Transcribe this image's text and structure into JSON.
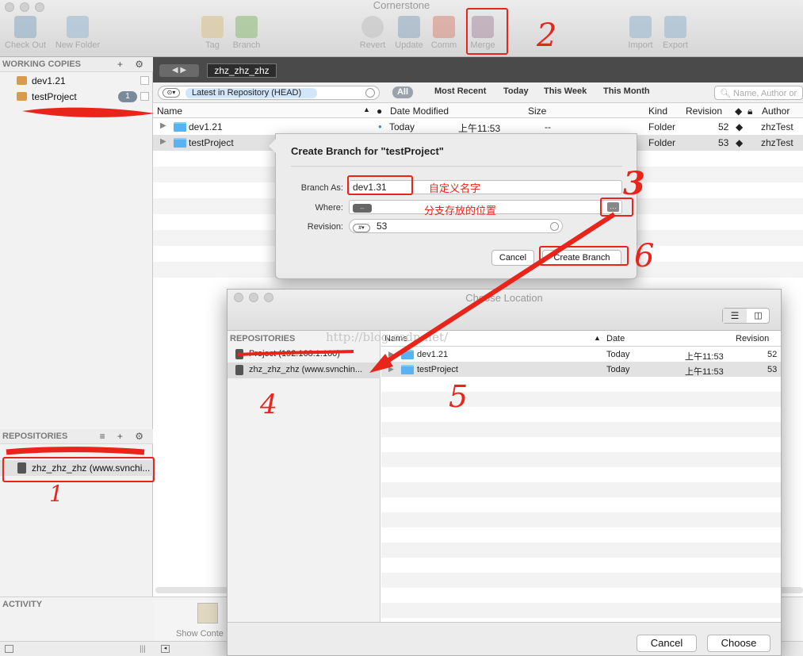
{
  "window": {
    "title": "Cornerstone"
  },
  "toolbar": [
    {
      "label": "Check Out"
    },
    {
      "label": "New Folder"
    },
    {
      "label": "Tag"
    },
    {
      "label": "Branch"
    },
    {
      "label": "Revert"
    },
    {
      "label": "Update"
    },
    {
      "label": "Comm"
    },
    {
      "label": "Merge"
    },
    {
      "label": "Import"
    },
    {
      "label": "Export"
    }
  ],
  "sidebar": {
    "working_copies_title": "WORKING COPIES",
    "working_copies": [
      {
        "name": "dev1.21"
      },
      {
        "name": "testProject",
        "badge": "1"
      }
    ],
    "repositories_title": "REPOSITORIES",
    "repositories": [
      {
        "name": "zhz_zhz_zhz (www.svnchi..."
      }
    ],
    "activity_title": "ACTIVITY"
  },
  "nav": {
    "path": "zhz_zhz_zhz"
  },
  "filter": {
    "revision_select": "Latest in Repository (HEAD)",
    "all": "All",
    "most_recent": "Most Recent",
    "today": "Today",
    "this_week": "This Week",
    "this_month": "This Month",
    "search_placeholder": "Name, Author or"
  },
  "columns": {
    "name": "Name",
    "date": "Date Modified",
    "size": "Size",
    "kind": "Kind",
    "revision": "Revision",
    "author": "Author"
  },
  "rows": [
    {
      "name": "dev1.21",
      "date": "Today",
      "time": "上午11:53",
      "size": "--",
      "kind": "Folder",
      "revision": "52",
      "author": "zhzTest"
    },
    {
      "name": "testProject",
      "kind": "Folder",
      "revision": "53",
      "author": "zhzTest"
    }
  ],
  "bottom": {
    "show_content": "Show Conte"
  },
  "create_branch": {
    "title": "Create Branch for \"testProject\"",
    "branch_as_label": "Branch As:",
    "branch_as_value": "dev1.31",
    "where_label": "Where:",
    "where_value": "--",
    "revision_label": "Revision:",
    "revision_value": "53",
    "cancel": "Cancel",
    "create": "Create Branch"
  },
  "choose_location": {
    "title": "Choose Location",
    "repositories_title": "REPOSITORIES",
    "repositories": [
      {
        "name": "Project (192.168.1.100)"
      },
      {
        "name": "zhz_zhz_zhz (www.svnchin..."
      }
    ],
    "col_name": "Name",
    "col_date": "Date",
    "col_revision": "Revision",
    "rows": [
      {
        "name": "dev1.21",
        "date": "Today",
        "time": "上午11:53",
        "revision": "52"
      },
      {
        "name": "testProject",
        "date": "Today",
        "time": "上午11:53",
        "revision": "53"
      }
    ],
    "cancel": "Cancel",
    "choose": "Choose"
  },
  "annotations": {
    "name_note": "自定义名字",
    "where_note": "分支存放的位置",
    "watermark": "http://blog.csdn.net/",
    "n1": "1",
    "n2": "2",
    "n3": "3",
    "n4": "4",
    "n5": "5",
    "n6": "6"
  },
  "colors": {
    "annotation": "#e8241b",
    "folder": "#5ab3f0",
    "selection": "#dcdcdc"
  }
}
